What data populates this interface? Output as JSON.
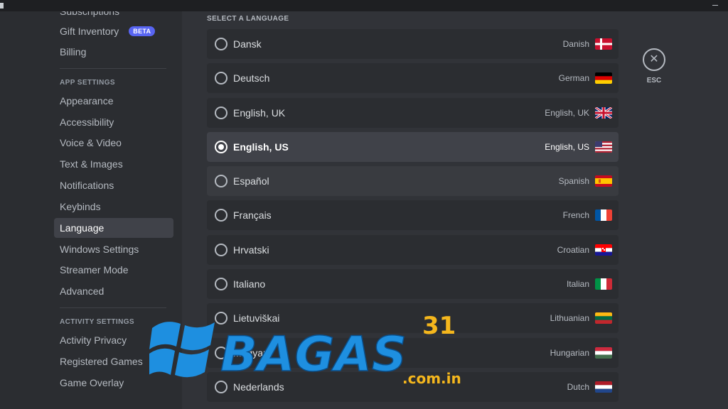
{
  "sidebar": {
    "items_top": [
      {
        "label": "Subscriptions"
      },
      {
        "label": "Gift Inventory",
        "badge": "BETA"
      },
      {
        "label": "Billing"
      }
    ],
    "app_settings": {
      "header": "APP SETTINGS",
      "items": [
        {
          "label": "Appearance"
        },
        {
          "label": "Accessibility"
        },
        {
          "label": "Voice & Video"
        },
        {
          "label": "Text & Images"
        },
        {
          "label": "Notifications"
        },
        {
          "label": "Keybinds"
        },
        {
          "label": "Language",
          "selected": true
        },
        {
          "label": "Windows Settings"
        },
        {
          "label": "Streamer Mode"
        },
        {
          "label": "Advanced"
        }
      ]
    },
    "activity_settings": {
      "header": "ACTIVITY SETTINGS",
      "items": [
        {
          "label": "Activity Privacy"
        },
        {
          "label": "Registered Games"
        },
        {
          "label": "Game Overlay"
        }
      ]
    }
  },
  "language": {
    "section_title": "SELECT A LANGUAGE",
    "options": [
      {
        "native": "Dansk",
        "english": "Danish",
        "flag": "flag-dk-icon"
      },
      {
        "native": "Deutsch",
        "english": "German",
        "flag": "flag-de-icon"
      },
      {
        "native": "English, UK",
        "english": "English, UK",
        "flag": "flag-gb-icon"
      },
      {
        "native": "English, US",
        "english": "English, US",
        "flag": "flag-us-icon",
        "selected": true
      },
      {
        "native": "Español",
        "english": "Spanish",
        "flag": "flag-es-icon",
        "hover": true
      },
      {
        "native": "Français",
        "english": "French",
        "flag": "flag-fr-icon"
      },
      {
        "native": "Hrvatski",
        "english": "Croatian",
        "flag": "flag-hr-icon"
      },
      {
        "native": "Italiano",
        "english": "Italian",
        "flag": "flag-it-icon"
      },
      {
        "native": "Lietuviškai",
        "english": "Lithuanian",
        "flag": "flag-lt-icon"
      },
      {
        "native": "Magyar",
        "english": "Hungarian",
        "flag": "flag-hu-icon"
      },
      {
        "native": "Nederlands",
        "english": "Dutch",
        "flag": "flag-nl-icon"
      }
    ]
  },
  "close": {
    "label": "ESC",
    "icon": "close-icon"
  },
  "watermark": {
    "text": "BAGAS",
    "superscript": "31",
    "domain": ".com.in",
    "logo": "windows-logo-icon"
  },
  "colors": {
    "background": "#313338",
    "sidebar": "#2b2d31",
    "selected": "#404249",
    "accent": "#5865f2",
    "watermark_blue": "#1e8fe0",
    "watermark_gold": "#f5b71d"
  }
}
